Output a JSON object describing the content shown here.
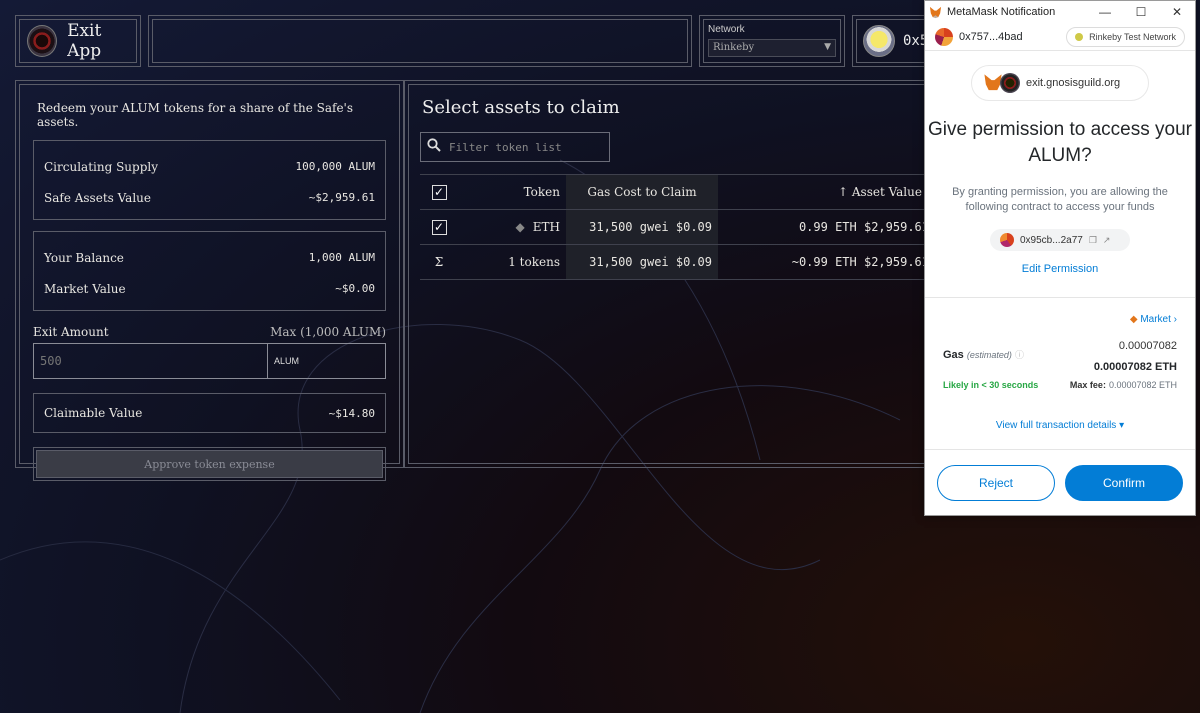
{
  "header": {
    "app_title": "Exit App",
    "network_label": "Network",
    "network_value": "Rinkeby",
    "account_prefix": "0x5"
  },
  "left": {
    "redeem_text": "Redeem your ALUM tokens for a share of the Safe's assets.",
    "circulating_supply_label": "Circulating Supply",
    "circulating_supply_value": "100,000 ALUM",
    "safe_assets_label": "Safe Assets Value",
    "safe_assets_value": "~$2,959.61",
    "your_balance_label": "Your Balance",
    "your_balance_value": "1,000 ALUM",
    "market_value_label": "Market Value",
    "market_value_value": "~$0.00",
    "exit_amount_label": "Exit Amount",
    "exit_max": "Max (1,000 ALUM)",
    "exit_placeholder": "500",
    "exit_unit": "ALUM",
    "claimable_label": "Claimable Value",
    "claimable_value": "~$14.80",
    "approve_label": "Approve token expense"
  },
  "right": {
    "title": "Select assets to claim",
    "filter_placeholder": "Filter token list",
    "columns": {
      "check": "✓",
      "token": "Token",
      "gas": "Gas Cost to Claim",
      "asset_value": "↑ Asset Value"
    },
    "rows": [
      {
        "check": "✓",
        "token": "ETH",
        "gas": "31,500 gwei $0.09",
        "value": "0.99 ETH $2,959.61"
      }
    ],
    "total": {
      "symbol": "Σ",
      "token": "1 tokens",
      "gas": "31,500 gwei $0.09",
      "value": "~0.99 ETH $2,959.61"
    }
  },
  "metamask": {
    "window_title": "MetaMask Notification",
    "account": "0x757...4bad",
    "network": "Rinkeby Test Network",
    "origin": "exit.gnosisguild.org",
    "heading": "Give permission to access your ALUM?",
    "description": "By granting permission, you are allowing the following contract to access your funds",
    "contract": "0x95cb...2a77",
    "edit_permission": "Edit Permission",
    "market": "Market",
    "gas_label": "Gas",
    "gas_estimated": "(estimated)",
    "gas_value": "0.00007082",
    "gas_value_eth": "0.00007082 ETH",
    "likely": "Likely in < 30 seconds",
    "max_fee_label": "Max fee:",
    "max_fee_value": "0.00007082 ETH",
    "view_full": "View full transaction details",
    "reject": "Reject",
    "confirm": "Confirm"
  },
  "colors": {
    "mm_blue": "#037dd6",
    "likely_green": "#28a745"
  }
}
